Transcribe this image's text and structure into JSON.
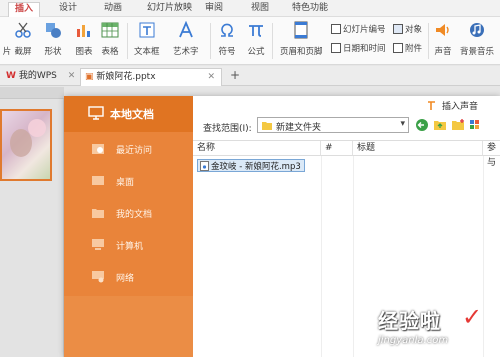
{
  "ribbon": {
    "tabs": [
      "插入",
      "设计",
      "动画",
      "幻灯片放映",
      "审阅",
      "视图",
      "特色功能"
    ],
    "active_tab": "插入",
    "buttons": {
      "partial": "片",
      "screenshot": "截屏",
      "shapes": "形状",
      "icons": "图表",
      "table": "表格",
      "textbox": "文本框",
      "wordart": "艺术字",
      "symbol": "符号",
      "formula": "公式",
      "header_footer": "页眉和页脚",
      "slide_number": "幻灯片编号",
      "object": "对象",
      "datetime": "日期和时间",
      "attachment": "附件",
      "audio": "声音",
      "bg_music": "背景音乐"
    }
  },
  "doc_tabs": [
    {
      "label": "我的WPS"
    },
    {
      "label": "新娘阿花.pptx",
      "active": true
    }
  ],
  "new_tab_symbol": "+",
  "dialog": {
    "sidebar": {
      "title": "本地文档",
      "items": [
        "最近访问",
        "桌面",
        "我的文档",
        "计算机",
        "网络"
      ]
    },
    "insert_sound_label": "插入声音",
    "lookin_label": "查找范围(I):",
    "lookin_value": "新建文件夹",
    "columns": [
      "名称",
      "#",
      "标题",
      "参与"
    ],
    "files": [
      "金玟岐 - 新娘阿花.mp3"
    ]
  },
  "watermark": {
    "text": "经验啦",
    "domain": "jingyanla.com"
  },
  "colors": {
    "accent_orange": "#e9843a",
    "sidebar_header": "#e07422",
    "selection_blue": "#dbe9f7"
  }
}
